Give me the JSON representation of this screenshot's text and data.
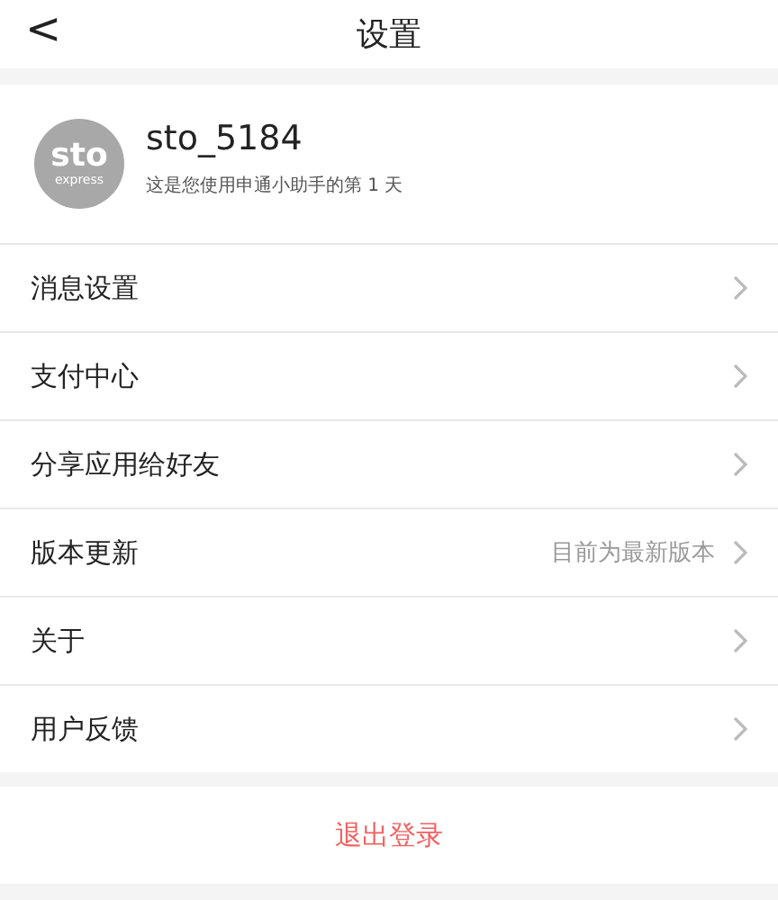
{
  "header": {
    "back": "<",
    "title": "设置"
  },
  "profile": {
    "logo_text": "sto",
    "logo_subtext": "express",
    "username": "sto_5184",
    "subtitle": "这是您使用申通小助手的第 1 天"
  },
  "items": [
    {
      "label": "消息设置"
    },
    {
      "label": "支付中心"
    },
    {
      "label": "分享应用给好友"
    },
    {
      "label": "版本更新",
      "value": "目前为最新版本"
    },
    {
      "label": "关于"
    },
    {
      "label": "用户反馈"
    }
  ],
  "logout": "退出登录"
}
